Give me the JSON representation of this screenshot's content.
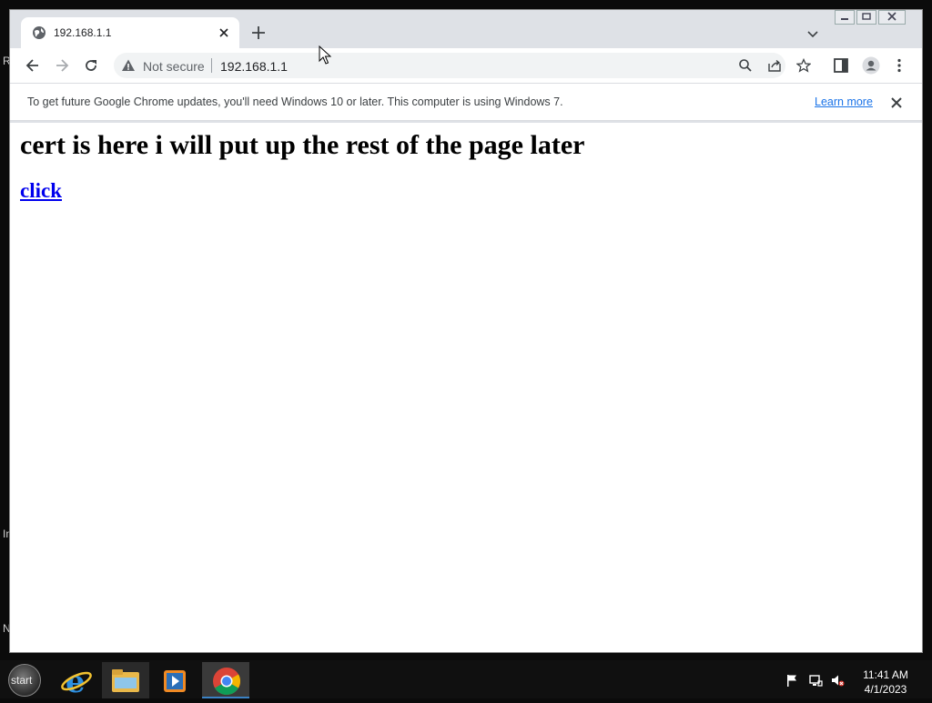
{
  "desktop": {
    "edge_letters": [
      "R",
      "In",
      "N"
    ]
  },
  "browser": {
    "tab": {
      "title": "192.168.1.1"
    },
    "omnibox": {
      "security_label": "Not secure",
      "url": "192.168.1.1"
    },
    "infobar": {
      "message": "To get future Google Chrome updates, you'll need Windows 10 or later. This computer is using Windows 7.",
      "link_label": "Learn more"
    }
  },
  "page": {
    "heading": "cert is here i will put up the rest of the page later",
    "link": "click"
  },
  "taskbar": {
    "start_label": "start",
    "apps": [
      "internet-explorer",
      "file-explorer",
      "media-player",
      "chrome"
    ],
    "clock": {
      "time": "11:41 AM",
      "date": "4/1/2023"
    }
  }
}
